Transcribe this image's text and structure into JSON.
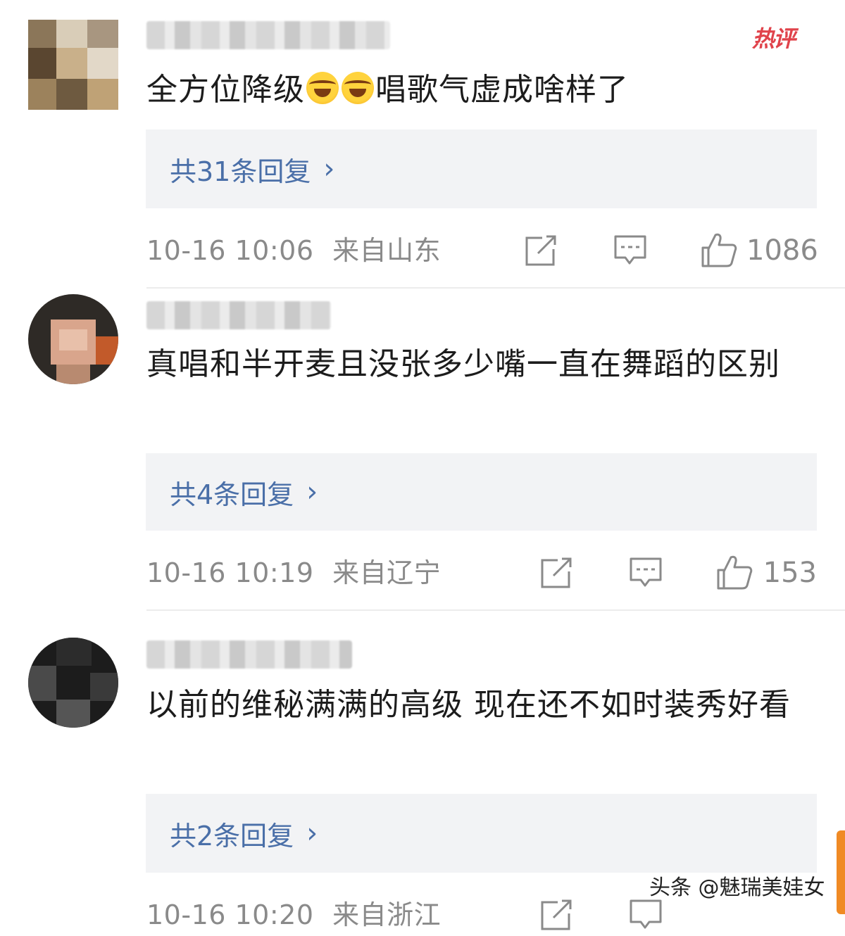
{
  "hot_badge": "热评",
  "comments": [
    {
      "text_before_emoji": "全方位降级",
      "emojis": [
        "laugh-cry-emoji",
        "laugh-cry-emoji"
      ],
      "text_after_emoji": "唱歌气虚成啥样了",
      "replies_label": "共31条回复",
      "timestamp": "10-16 10:06",
      "location": "来自山东",
      "likes": "1086"
    },
    {
      "text": "真唱和半开麦且没张多少嘴一直在舞蹈的区别",
      "replies_label": "共4条回复",
      "timestamp": "10-16 10:19",
      "location": "来自辽宁",
      "likes": "153"
    },
    {
      "text": "以前的维秘满满的高级 现在还不如时装秀好看",
      "replies_label": "共2条回复",
      "timestamp": "10-16 10:20",
      "location": "来自浙江"
    }
  ],
  "chevron": "›",
  "watermark": "头条 @魅瑞美娃女",
  "colors": {
    "link_blue": "#4a6fa8",
    "meta_gray": "#8a8a8a",
    "reply_bg": "#f2f3f5",
    "hot_red": "#e0434b"
  }
}
